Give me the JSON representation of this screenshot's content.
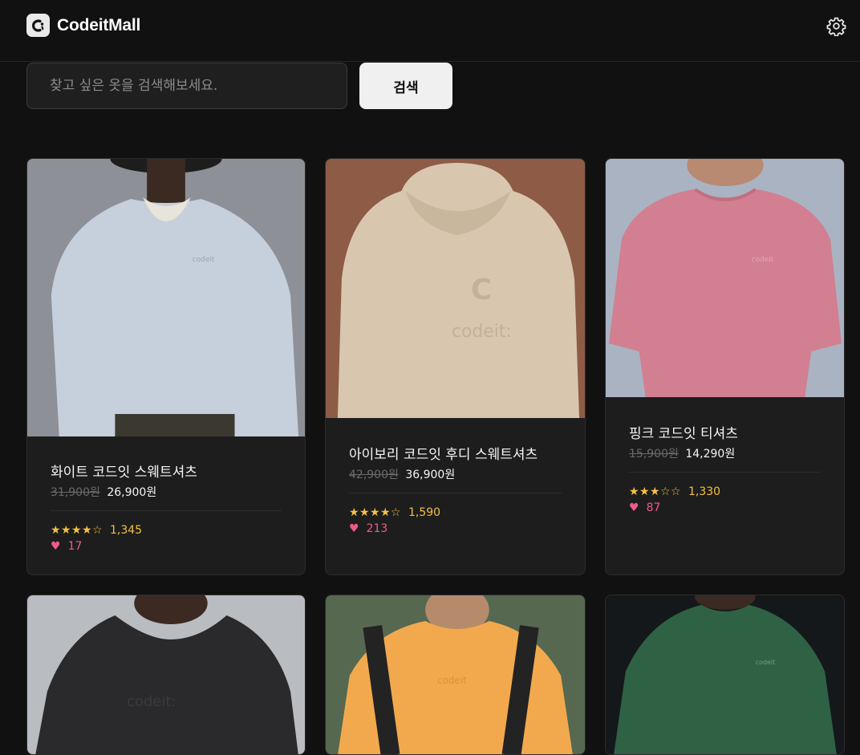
{
  "header": {
    "logo_text": "CodeitMall",
    "settings_icon": "gear-icon"
  },
  "search": {
    "placeholder": "찾고 싶은 옷을 검색해보세요.",
    "value": "",
    "button_label": "검색"
  },
  "colors": {
    "background": "#111111",
    "card": "#1d1d1d",
    "star": "#f5c142",
    "heart": "#ee5a87"
  },
  "products": [
    {
      "name": "화이트 코드잇 스웨트셔츠",
      "original_price": "31,900원",
      "sale_price": "26,900원",
      "rating": 4,
      "review_count": "1,345",
      "likes": "17",
      "image_color": "#c9d2dd"
    },
    {
      "name": "아이보리 코드잇 후디 스웨트셔츠",
      "original_price": "42,900원",
      "sale_price": "36,900원",
      "rating": 4,
      "review_count": "1,590",
      "likes": "213",
      "image_color": "#dac9b1"
    },
    {
      "name": "핑크 코드잇 티셔츠",
      "original_price": "15,900원",
      "sale_price": "14,290원",
      "rating": 3,
      "review_count": "1,330",
      "likes": "87",
      "image_color": "#d27f92"
    },
    {
      "name": "",
      "image_color": "#2a2a2c"
    },
    {
      "name": "",
      "image_color": "#f2a94e"
    },
    {
      "name": "",
      "image_color": "#2f6244"
    }
  ]
}
